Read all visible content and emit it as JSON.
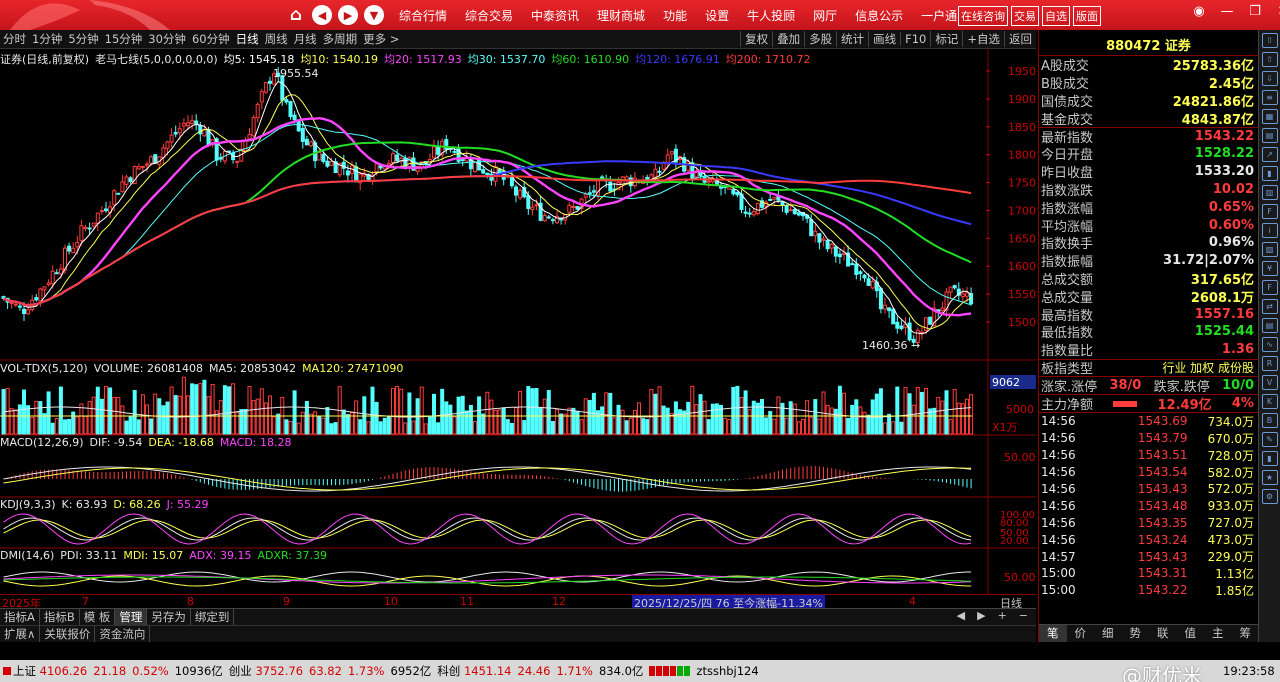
{
  "topbar": {
    "menu": [
      "综合行情",
      "综合交易",
      "中泰资讯",
      "理财商城",
      "功能",
      "设置",
      "牛人投顾",
      "网厅",
      "信息公示",
      "一户通"
    ],
    "right_buttons": [
      "在线咨询",
      "交易",
      "自选",
      "版面"
    ]
  },
  "periodbar": {
    "items": [
      "分时",
      "1分钟",
      "5分钟",
      "15分钟",
      "30分钟",
      "60分钟",
      "日线",
      "周线",
      "月线",
      "多周期",
      "更多 >"
    ],
    "active": "日线",
    "right_buttons": [
      "复权",
      "叠加",
      "多股",
      "统计",
      "画线",
      "F10",
      "标记",
      "+自选",
      "返回"
    ]
  },
  "main_legend": {
    "title": "证券(日线,前复权)",
    "indicator": "老马七线(5,0,0,0,0,0,0)",
    "ma": [
      {
        "label": "均5: 1545.18",
        "color": "#ffffff"
      },
      {
        "label": "均10: 1540.19",
        "color": "#ffff54"
      },
      {
        "label": "均20: 1517.93",
        "color": "#ff44ff"
      },
      {
        "label": "均30: 1537.70",
        "color": "#54ffff"
      },
      {
        "label": "均60: 1610.90",
        "color": "#22dd22"
      },
      {
        "label": "均120: 1676.91",
        "color": "#3a3aff"
      },
      {
        "label": "均200: 1710.72",
        "color": "#ff3c3c"
      }
    ]
  },
  "price_axis": [
    "1950",
    "1900",
    "1850",
    "1800",
    "1750",
    "1700",
    "1650",
    "1600",
    "1550",
    "1500"
  ],
  "annotations": {
    "high": "1955.54",
    "low": "1460.36"
  },
  "vol_legend": {
    "name": "VOL-TDX(5,120)",
    "items": [
      {
        "label": "VOLUME: 26081408",
        "color": "#e8e8e8"
      },
      {
        "label": "MA5: 20853042",
        "color": "#e8e8e8"
      },
      {
        "label": "MA120: 27471090",
        "color": "#ffff54"
      }
    ],
    "axis_top": "9062",
    "axis_mid": "5000",
    "axis_unit": "X1万"
  },
  "macd_legend": {
    "name": "MACD(12,26,9)",
    "items": [
      {
        "label": "DIF: -9.54",
        "color": "#e8e8e8"
      },
      {
        "label": "DEA: -18.68",
        "color": "#ffff54"
      },
      {
        "label": "MACD: 18.28",
        "color": "#ff44ff"
      }
    ],
    "axis": "50.00"
  },
  "kdj_legend": {
    "name": "KDJ(9,3,3)",
    "items": [
      {
        "label": "K: 63.93",
        "color": "#e8e8e8"
      },
      {
        "label": "D: 68.26",
        "color": "#ffff54"
      },
      {
        "label": "J: 55.29",
        "color": "#ff44ff"
      }
    ],
    "axis": [
      "100.00",
      "80.00",
      "50.00",
      "20.00"
    ]
  },
  "dmi_legend": {
    "name": "DMI(14,6)",
    "items": [
      {
        "label": "PDI: 33.11",
        "color": "#e8e8e8"
      },
      {
        "label": "MDI: 15.07",
        "color": "#ffff54"
      },
      {
        "label": "ADX: 39.15",
        "color": "#ff44ff"
      },
      {
        "label": "ADXR: 37.39",
        "color": "#22dd22"
      }
    ],
    "axis": "50.00"
  },
  "date_axis": {
    "labels": [
      "2025年",
      "7",
      "8",
      "9",
      "10",
      "11",
      "12",
      "4"
    ],
    "highlight": "2025/12/25/四 76 至今涨幅-11.34%",
    "period": "日线"
  },
  "indicator_tabs": [
    "指标A",
    "指标B",
    "模 板",
    "管理",
    "另存为",
    "绑定到"
  ],
  "indicator_tabs_active": "管理",
  "bottom_tabs": [
    "扩展∧",
    "关联报价",
    "资金流向"
  ],
  "right_panel": {
    "title": "880472 证券",
    "stats": [
      {
        "label": "A股成交",
        "value": "25783.36亿",
        "color": "yellow"
      },
      {
        "label": "B股成交",
        "value": "2.45亿",
        "color": "yellow"
      },
      {
        "label": "国债成交",
        "value": "24821.86亿",
        "color": "yellow"
      },
      {
        "label": "基金成交",
        "value": "4843.87亿",
        "color": "yellow"
      },
      {
        "label": "最新指数",
        "value": "1543.22",
        "color": "red"
      },
      {
        "label": "今日开盘",
        "value": "1528.22",
        "color": "green"
      },
      {
        "label": "昨日收盘",
        "value": "1533.20",
        "color": "white"
      },
      {
        "label": "指数涨跌",
        "value": "10.02",
        "color": "red"
      },
      {
        "label": "指数涨幅",
        "value": "0.65%",
        "color": "red"
      },
      {
        "label": "平均涨幅",
        "value": "0.60%",
        "color": "red"
      },
      {
        "label": "指数换手",
        "value": "0.96%",
        "color": "white"
      },
      {
        "label": "指数振幅",
        "value": "31.72|2.07%",
        "color": "white"
      },
      {
        "label": "总成交额",
        "value": "317.65亿",
        "color": "yellow"
      },
      {
        "label": "总成交量",
        "value": "2608.1万",
        "color": "yellow"
      },
      {
        "label": "最高指数",
        "value": "1557.16",
        "color": "red"
      },
      {
        "label": "最低指数",
        "value": "1525.44",
        "color": "green"
      },
      {
        "label": "指数量比",
        "value": "1.36",
        "color": "red"
      }
    ],
    "type_row": {
      "label": "板指类型",
      "value": "行业 加权 成份股"
    },
    "updown_row": {
      "up_label": "涨家.涨停",
      "up_value": "38/0",
      "down_label": "跌家.跌停",
      "down_value": "10/0"
    },
    "netflow_row": {
      "label": "主力净额",
      "value": "12.49亿",
      "pct": "4%"
    },
    "ticks": [
      {
        "time": "14:56",
        "price": "1543.69",
        "vol": "734.0万"
      },
      {
        "time": "14:56",
        "price": "1543.79",
        "vol": "670.0万"
      },
      {
        "time": "14:56",
        "price": "1543.51",
        "vol": "728.0万"
      },
      {
        "time": "14:56",
        "price": "1543.54",
        "vol": "582.0万"
      },
      {
        "time": "14:56",
        "price": "1543.43",
        "vol": "572.0万"
      },
      {
        "time": "14:56",
        "price": "1543.48",
        "vol": "933.0万"
      },
      {
        "time": "14:56",
        "price": "1543.35",
        "vol": "727.0万"
      },
      {
        "time": "14:56",
        "price": "1543.24",
        "vol": "473.0万"
      },
      {
        "time": "14:57",
        "price": "1543.43",
        "vol": "229.0万"
      },
      {
        "time": "15:00",
        "price": "1543.31",
        "vol": "1.13亿"
      },
      {
        "time": "15:00",
        "price": "1543.22",
        "vol": "1.85亿"
      }
    ],
    "bottom_tabs": [
      "笔",
      "价",
      "细",
      "势",
      "联",
      "值",
      "主",
      "筹"
    ],
    "bottom_active": "笔"
  },
  "statusbar": {
    "sh_label": "上证",
    "sh_value": "4106.26",
    "sh_change": "21.18",
    "sh_pct": "0.52%",
    "sh_amount": "10936亿",
    "cy_label": "创业",
    "cy_value": "3752.76",
    "cy_change": "63.82",
    "cy_pct": "1.73%",
    "cy_amount": "6952亿",
    "kc_label": "科创",
    "kc_value": "1451.14",
    "kc_change": "24.46",
    "kc_pct": "1.71%",
    "kc_amount": "834.0亿",
    "user": "ztsshbj124",
    "time": "19:23:58",
    "watermark": "@财优米"
  }
}
